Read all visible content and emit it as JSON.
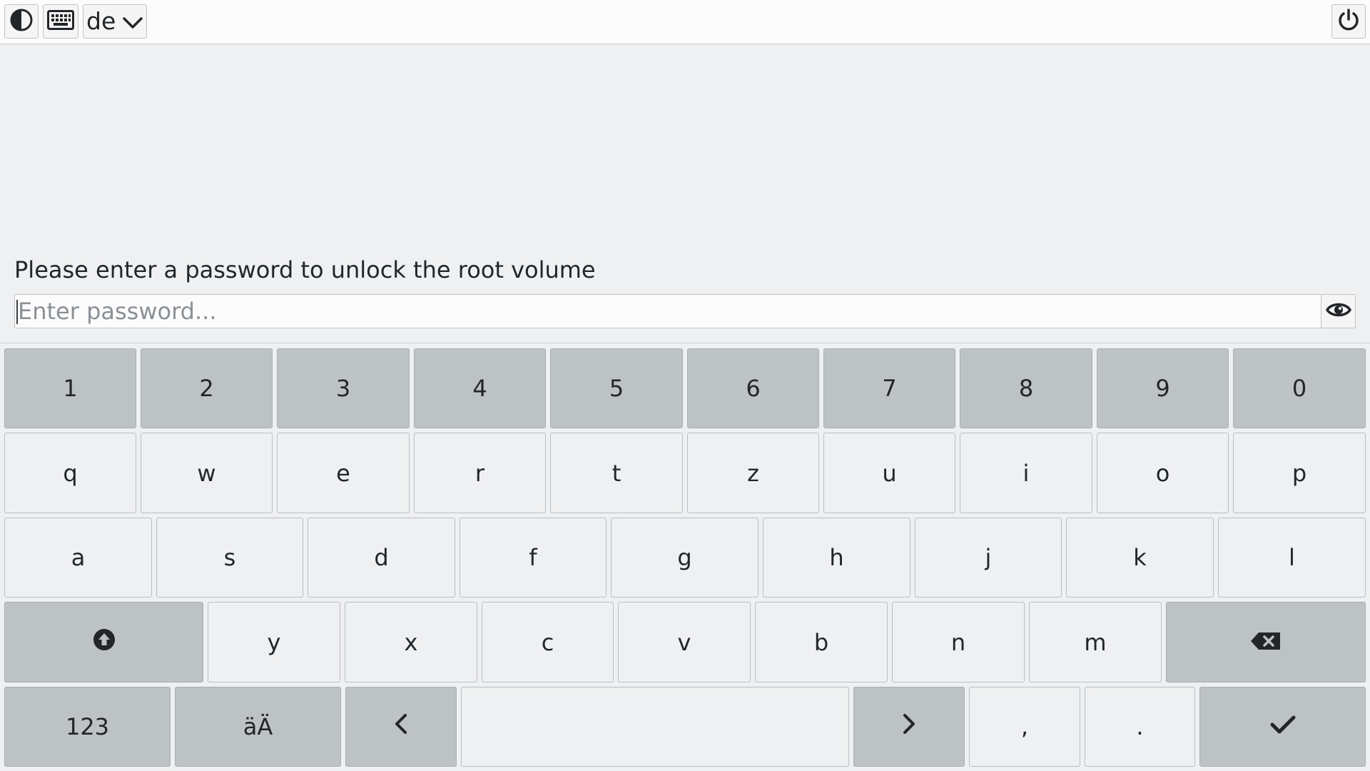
{
  "topbar": {
    "contrast_icon": "contrast-icon",
    "keyboard_icon": "keyboard-icon",
    "language": "de",
    "language_dropdown_icon": "chevron-down-icon",
    "power_icon": "power-icon"
  },
  "prompt": {
    "label": "Please enter a password to unlock the root volume",
    "placeholder": "Enter password...",
    "value": "",
    "toggle_icon": "eye-icon"
  },
  "keyboard": {
    "digits": [
      "1",
      "2",
      "3",
      "4",
      "5",
      "6",
      "7",
      "8",
      "9",
      "0"
    ],
    "row1": [
      "q",
      "w",
      "e",
      "r",
      "t",
      "z",
      "u",
      "i",
      "o",
      "p"
    ],
    "row2": [
      "a",
      "s",
      "d",
      "f",
      "g",
      "h",
      "j",
      "k",
      "l"
    ],
    "row3": [
      "y",
      "x",
      "c",
      "v",
      "b",
      "n",
      "m"
    ],
    "shift_icon": "shift-icon",
    "backspace_icon": "backspace-icon",
    "numbers_label": "123",
    "umlaut_label": "äÄ",
    "left_icon": "chevron-left-icon",
    "space_label": "",
    "right_icon": "chevron-right-icon",
    "comma_label": ",",
    "period_label": ".",
    "enter_icon": "check-icon"
  },
  "colors": {
    "background": "#eff0f1",
    "key_dark": "#bdc2c5",
    "key_light": "#eff0f1",
    "text": "#232629"
  }
}
